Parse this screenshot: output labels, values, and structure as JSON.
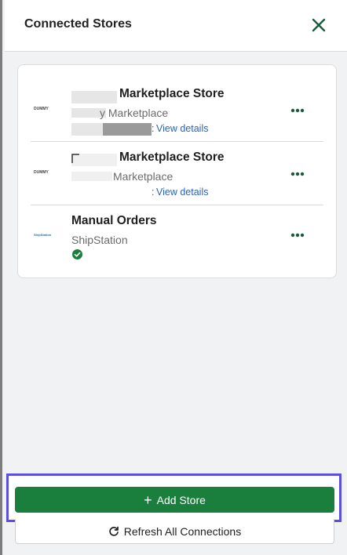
{
  "header": {
    "title": "Connected Stores"
  },
  "stores": [
    {
      "logo": "DUMMY",
      "name_visible": "Marketplace Store",
      "sub_visible": "y Marketplace",
      "view_details": "View details"
    },
    {
      "logo": "DUMMY",
      "name_visible": "Marketplace Store",
      "sub_visible": "Marketplace",
      "view_details": "View details"
    },
    {
      "logo": "ShipStation",
      "name": "Manual Orders",
      "sub": "ShipStation"
    }
  ],
  "footer": {
    "add_label": "Add Store",
    "refresh_label": "Refresh All Connections"
  },
  "colors": {
    "primary_green": "#1a7f3c",
    "link_blue": "#2c63b5",
    "highlight": "#5b4fe0"
  }
}
